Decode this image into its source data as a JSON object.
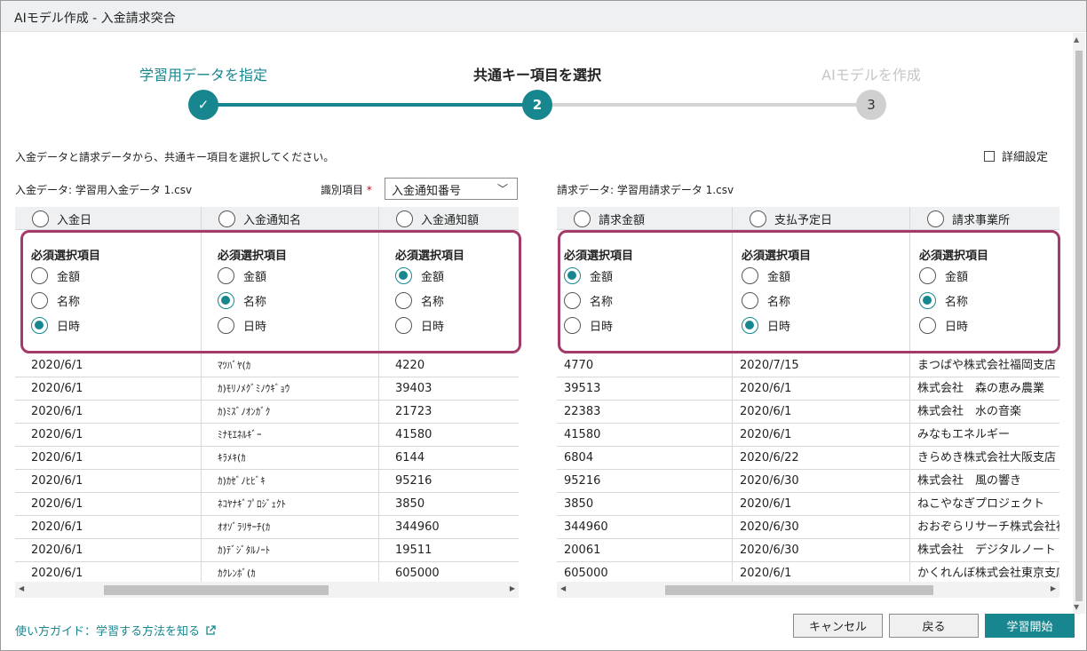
{
  "window": {
    "title": "AIモデル作成 - 入金請求突合"
  },
  "stepper": {
    "steps": [
      {
        "label": "学習用データを指定",
        "marker": "✓",
        "state": "done"
      },
      {
        "label": "共通キー項目を選択",
        "marker": "2",
        "state": "current"
      },
      {
        "label": "AIモデルを作成",
        "marker": "3",
        "state": "pending"
      }
    ]
  },
  "instruction": "入金データと請求データから、共通キー項目を選択してください。",
  "advanced_settings": {
    "label": "詳細設定",
    "checked": false
  },
  "left": {
    "source_label": "入金データ: 学習用入金データ 1.csv",
    "id_field_label": "識別項目",
    "id_field_required": "*",
    "id_field_value": "入金通知番号",
    "columns": [
      {
        "name": "入金日",
        "selected": false,
        "required_title": "必須選択項目",
        "options": [
          {
            "label": "金額",
            "checked": false
          },
          {
            "label": "名称",
            "checked": false
          },
          {
            "label": "日時",
            "checked": true
          }
        ]
      },
      {
        "name": "入金通知名",
        "selected": false,
        "required_title": "必須選択項目",
        "options": [
          {
            "label": "金額",
            "checked": false
          },
          {
            "label": "名称",
            "checked": true
          },
          {
            "label": "日時",
            "checked": false
          }
        ]
      },
      {
        "name": "入金通知額",
        "selected": false,
        "required_title": "必須選択項目",
        "options": [
          {
            "label": "金額",
            "checked": true
          },
          {
            "label": "名称",
            "checked": false
          },
          {
            "label": "日時",
            "checked": false
          }
        ]
      }
    ],
    "rows": [
      [
        "2020/6/1",
        "ﾏﾂﾊﾞﾔ(ｶ",
        "4220"
      ],
      [
        "2020/6/1",
        "ｶ)ﾓﾘﾉﾒｸﾞﾐﾉｳｷﾞｮｳ",
        "39403"
      ],
      [
        "2020/6/1",
        "ｶ)ﾐｽﾞﾉｵﾝｶﾞｸ",
        "21723"
      ],
      [
        "2020/6/1",
        "ﾐﾅﾓｴﾈﾙｷﾞｰ",
        "41580"
      ],
      [
        "2020/6/1",
        "ｷﾗﾒｷ(ｶ",
        "6144"
      ],
      [
        "2020/6/1",
        "ｶ)ｶｾﾞﾉﾋﾋﾞｷ",
        "95216"
      ],
      [
        "2020/6/1",
        "ﾈｺﾔﾅｷﾞﾌﾟﾛｼﾞｪｸﾄ",
        "3850"
      ],
      [
        "2020/6/1",
        "ｵｵｿﾞﾗﾘｻｰﾁ(ｶ",
        "344960"
      ],
      [
        "2020/6/1",
        "ｶ)ﾃﾞｼﾞﾀﾙﾉｰﾄ",
        "19511"
      ],
      [
        "2020/6/1",
        "ｶｸﾚﾝﾎﾞ(ｶ",
        "605000"
      ]
    ]
  },
  "right": {
    "source_label": "請求データ: 学習用請求データ 1.csv",
    "columns": [
      {
        "name": "請求金額",
        "selected": false,
        "required_title": "必須選択項目",
        "options": [
          {
            "label": "金額",
            "checked": true
          },
          {
            "label": "名称",
            "checked": false
          },
          {
            "label": "日時",
            "checked": false
          }
        ]
      },
      {
        "name": "支払予定日",
        "selected": false,
        "required_title": "必須選択項目",
        "options": [
          {
            "label": "金額",
            "checked": false
          },
          {
            "label": "名称",
            "checked": false
          },
          {
            "label": "日時",
            "checked": true
          }
        ]
      },
      {
        "name": "請求事業所",
        "selected": false,
        "required_title": "必須選択項目",
        "options": [
          {
            "label": "金額",
            "checked": false
          },
          {
            "label": "名称",
            "checked": true
          },
          {
            "label": "日時",
            "checked": false
          }
        ]
      }
    ],
    "rows": [
      [
        "4770",
        "2020/7/15",
        "まつばや株式会社福岡支店"
      ],
      [
        "39513",
        "2020/6/1",
        "株式会社　森の恵み農業"
      ],
      [
        "22383",
        "2020/6/1",
        "株式会社　水の音楽"
      ],
      [
        "41580",
        "2020/6/1",
        "みなもエネルギー"
      ],
      [
        "6804",
        "2020/6/22",
        "きらめき株式会社大阪支店"
      ],
      [
        "95216",
        "2020/6/30",
        "株式会社　風の響き"
      ],
      [
        "3850",
        "2020/6/1",
        "ねこやなぎプロジェクト"
      ],
      [
        "344960",
        "2020/6/30",
        "おおぞらリサーチ株式会社福井"
      ],
      [
        "20061",
        "2020/6/30",
        "株式会社　デジタルノート"
      ],
      [
        "605000",
        "2020/6/1",
        "かくれんぼ株式会社東京支店"
      ]
    ]
  },
  "footer": {
    "guide_link": "使い方ガイド：学習する方法を知る",
    "cancel": "キャンセル",
    "back": "戻る",
    "start": "学習開始"
  },
  "colors": {
    "accent": "#17868f",
    "highlight_frame": "#a33a6a"
  }
}
